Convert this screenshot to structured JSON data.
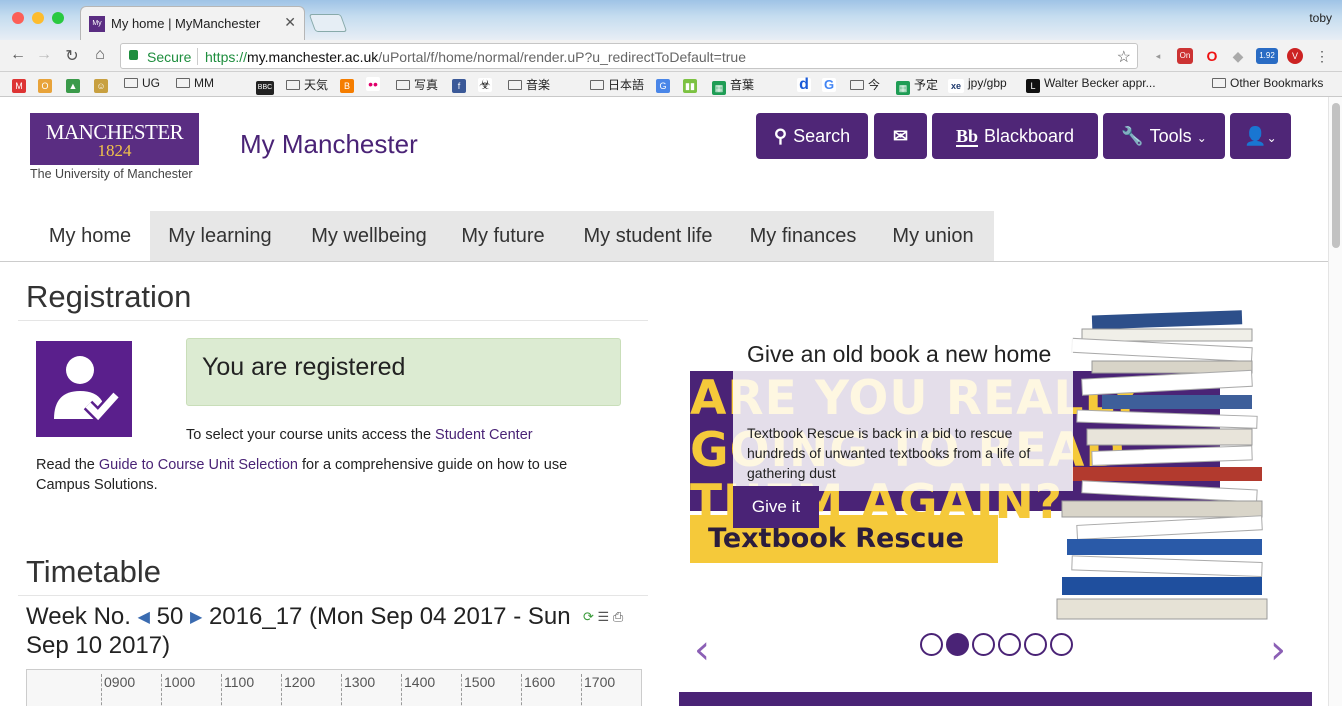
{
  "browser": {
    "tab_title": "My home | MyManchester",
    "tab_favicon": "My",
    "user": "toby",
    "secure_label": "Secure",
    "url_scheme": "https://",
    "url_domain": "my.manchester.ac.uk",
    "url_path": "/uPortal/f/home/normal/render.uP?u_redirectToDefault=true",
    "bookmarks": [
      "UG",
      "MM",
      "天気",
      "写真",
      "音楽",
      "日本語",
      "音葉",
      "今",
      "予定",
      "jpy/gbp",
      "Walter Becker appr...",
      "Other Bookmarks"
    ],
    "ext_badge": "1.92",
    "ext_on": "On"
  },
  "header": {
    "logo_line1": "MANCHESTER",
    "logo_line2": "1824",
    "logo_sub": "The University of Manchester",
    "brand": "My Manchester",
    "buttons": {
      "search": "Search",
      "blackboard": "Blackboard",
      "blackboard_glyph": "Bb",
      "tools": "Tools"
    }
  },
  "nav": {
    "tabs": [
      "My home",
      "My learning",
      "My wellbeing",
      "My future",
      "My student life",
      "My finances",
      "My union"
    ]
  },
  "registration": {
    "heading": "Registration",
    "status": "You are registered",
    "select_text": "To select your course units access the ",
    "student_center": "Student Center",
    "read_text": "Read the ",
    "guide_link": "Guide to Course Unit Selection",
    "guide_text": " for a comprehensive guide on how to use Campus Solutions."
  },
  "timetable": {
    "heading": "Timetable",
    "week_label": "Week No.",
    "week_number": "50",
    "period": "2016_17 (Mon Sep 04 2017 - Sun Sep 10 2017)",
    "hours": [
      "0900",
      "1000",
      "1100",
      "1200",
      "1300",
      "1400",
      "1500",
      "1600",
      "1700"
    ]
  },
  "slide": {
    "title": "Give an old book a new home",
    "body": "Textbook Rescue is back in a bid to rescue hundreds of unwanted textbooks from a life of gathering dust",
    "button": "Give it",
    "hero_line1": "ARE YOU REALLY",
    "hero_line2": "GOING TO READ",
    "hero_line3": "THEM AGAIN?",
    "banner": "Textbook Rescue",
    "active_dot": 2,
    "dot_count": 6
  },
  "colors": {
    "brand_purple": "#4a2376",
    "brand_gold": "#f5c93a",
    "success_bg": "#dcebd2"
  }
}
